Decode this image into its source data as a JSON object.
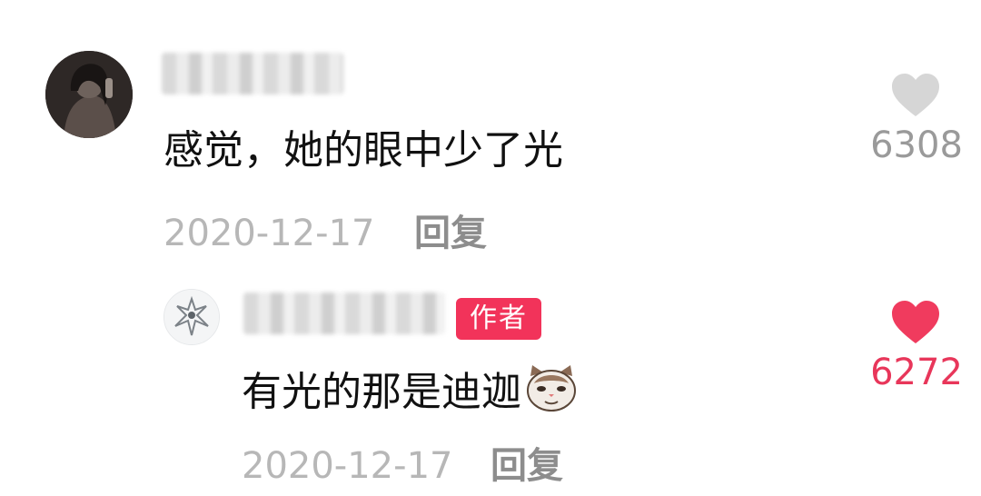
{
  "comments": {
    "main": {
      "username": "",
      "text": "感觉，她的眼中少了光",
      "date": "2020-12-17",
      "reply_label": "回复",
      "likes": "6308",
      "liked": false
    },
    "reply": {
      "username": "",
      "badge": "作者",
      "text": "有光的那是迪迦",
      "emoji": "cat-face-emoji",
      "date": "2020-12-17",
      "reply_label": "回复",
      "likes": "6272",
      "liked": true
    }
  },
  "colors": {
    "badge_bg": "#f2335a",
    "heart_unliked": "#d6d6d6",
    "heart_liked": "#f03b5e",
    "text_primary": "#111111",
    "text_meta": "#b7b7b7"
  }
}
